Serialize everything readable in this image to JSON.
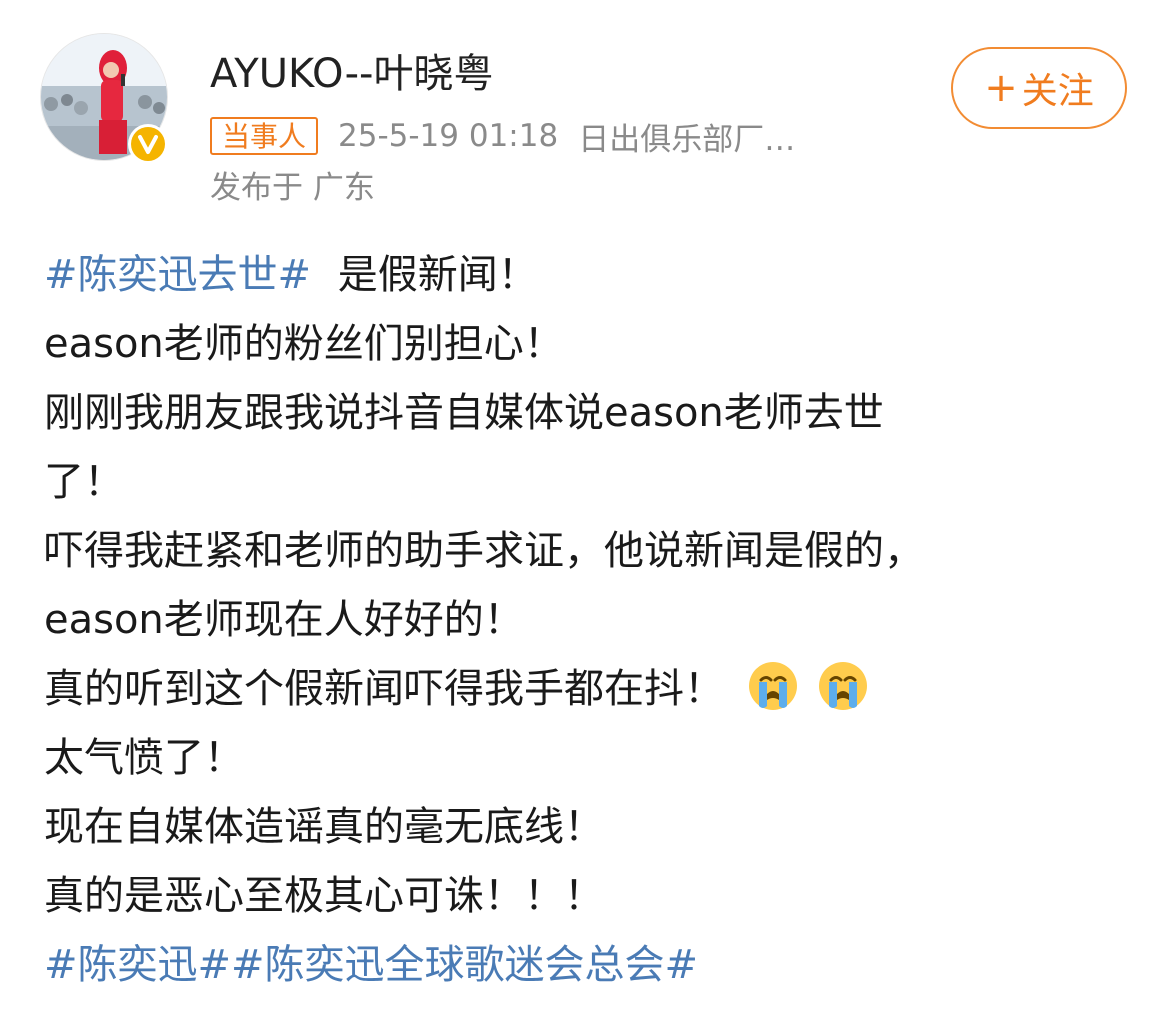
{
  "post": {
    "author": {
      "name": "AYUKO--叶晓粤",
      "role_badge": "当事人",
      "verified": true
    },
    "timestamp": "25-5-19 01:18",
    "source": "日出俱乐部厂…",
    "location": "发布于 广东",
    "follow_button": {
      "label": "关注",
      "icon": "plus-icon"
    },
    "colors": {
      "accent": "#f07c1f",
      "hashtag": "#4a7bb5",
      "text": "#1a1a1a",
      "meta": "#8a8a8a"
    },
    "content": {
      "line1_hashtag": "#陈奕迅去世#",
      "line1_text": "是假新闻！",
      "line2": "eason老师的粉丝们别担心！",
      "line3": "刚刚我朋友跟我说抖音自媒体说eason老师去世",
      "line4": "了！",
      "line5": "吓得我赶紧和老师的助手求证，他说新闻是假的，",
      "line6": "eason老师现在人好好的！",
      "line7": "真的听到这个假新闻吓得我手都在抖！",
      "line7_emojis": [
        "crying-face-icon",
        "crying-face-icon"
      ],
      "line8": "太气愤了！",
      "line9": "现在自媒体造谣真的毫无底线！",
      "line10": "真的是恶心至极其心可诛！！！",
      "hashtags_end": [
        "#陈奕迅#",
        "#陈奕迅全球歌迷会总会#"
      ]
    }
  }
}
